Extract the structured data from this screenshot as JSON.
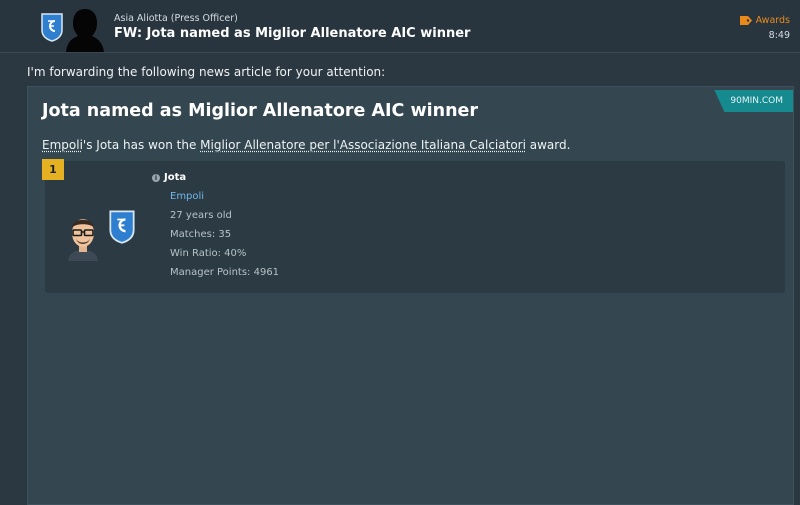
{
  "header": {
    "sender": "Asia Aliotta  (Press Officer)",
    "subject": "FW: Jota named as Miglior Allenatore AIC winner",
    "category": "Awards",
    "time": "8:49"
  },
  "intro": "I'm forwarding the following news article for your attention:",
  "article": {
    "source": "90MIN.COM",
    "headline": "Jota named as Miglior Allenatore AIC winner",
    "body": {
      "club": "Empoli",
      "mid1": "'s ",
      "person": "Jota",
      "mid2": " has won the ",
      "award": "Miglior Allenatore per l'Associazione Italiana Calciatori",
      "end": " award."
    }
  },
  "winner": {
    "rank": "1",
    "name": "Jota",
    "club": "Empoli",
    "age": "27 years old",
    "matches": "Matches: 35",
    "win_ratio": "Win Ratio: 40%",
    "manager_points": "Manager Points: 4961"
  },
  "icons": {
    "crest": "empoli-crest-icon",
    "category": "tag-icon",
    "info": "info-icon"
  },
  "colors": {
    "accent_orange": "#e98a1a",
    "badge_teal": "#158a8f",
    "rank_gold": "#e5b122",
    "link_blue": "#6fb7e8"
  }
}
